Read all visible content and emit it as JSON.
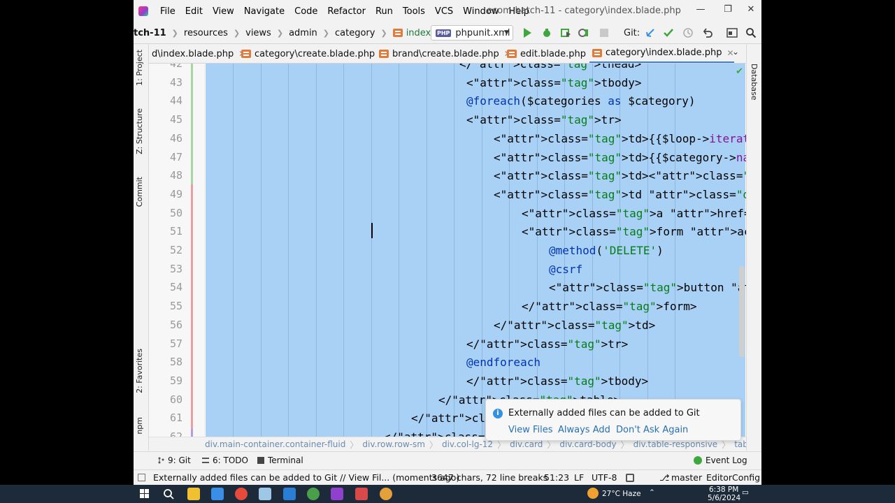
{
  "menubar": {
    "items": [
      "File",
      "Edit",
      "View",
      "Navigate",
      "Code",
      "Refactor",
      "Run",
      "Tools",
      "VCS",
      "Window",
      "Help"
    ],
    "window_title": "ecom-batch-11 - category\\index.blade.php"
  },
  "navbar": {
    "project": "tch-11",
    "crumbs": [
      "resources",
      "views",
      "admin",
      "category",
      "index.blade.php"
    ],
    "run_config": "phpunit.xml",
    "git_label": "Git:"
  },
  "tool_windows_left": [
    "1: Project",
    "Z: Structure",
    "Commit",
    "2: Favorites",
    "npm"
  ],
  "tool_windows_right": [
    "Database"
  ],
  "tabs": [
    {
      "label": "d\\index.blade.php"
    },
    {
      "label": "category\\create.blade.php"
    },
    {
      "label": "brand\\create.blade.php"
    },
    {
      "label": "edit.blade.php"
    },
    {
      "label": "category\\index.blade.php"
    }
  ],
  "editor": {
    "lines": [
      {
        "num": "42",
        "text": "</thead>"
      },
      {
        "num": "43",
        "text": "<tbody>"
      },
      {
        "num": "44",
        "text": "@foreach($categories as $category)"
      },
      {
        "num": "45",
        "text": "<tr>"
      },
      {
        "num": "46",
        "text": "<td>{{$loop->iteration}}</td>"
      },
      {
        "num": "47",
        "text": "<td>{{$category->name}}</td>"
      },
      {
        "num": "48",
        "text": "<td><img src=\"{{asset($category->im"
      },
      {
        "num": "49",
        "text": "<td class=\"d-flex\">"
      },
      {
        "num": "50",
        "text": "<a href=\"{{route('category.edit"
      },
      {
        "num": "51",
        "text": "<form action=\"{{route('category"
      },
      {
        "num": "52",
        "text": "@method('DELETE')"
      },
      {
        "num": "53",
        "text": "@csrf"
      },
      {
        "num": "54",
        "text": "<button type=\"submit\" class"
      },
      {
        "num": "55",
        "text": "</form>"
      },
      {
        "num": "56",
        "text": "</td>"
      },
      {
        "num": "57",
        "text": "</tr>"
      },
      {
        "num": "58",
        "text": "@endforeach"
      },
      {
        "num": "59",
        "text": "</tbody>"
      },
      {
        "num": "60",
        "text": "</table>"
      },
      {
        "num": "61",
        "text": "</div>"
      },
      {
        "num": "62",
        "text": "</div>"
      }
    ],
    "breadcrumbs": [
      "div.main-container.container-fluid",
      "div.row.row-sm",
      "div.col-lg-12",
      "div.card",
      "div.card-body",
      "div.table-responsive",
      "table#basic-data"
    ]
  },
  "notification": {
    "message": "Externally added files can be added to Git",
    "actions": [
      "View Files",
      "Always Add",
      "Don't Ask Again"
    ]
  },
  "bottom_tools": {
    "git": "9: Git",
    "todo": "6: TODO",
    "terminal": "Terminal",
    "event_log": "Event Log"
  },
  "statusbar": {
    "message": "Externally added files can be added to Git // View Fil... (moments ago)",
    "chars": "3647 chars, 72 line breaks",
    "position": "51:23",
    "line_sep": "LF",
    "encoding": "UTF-8",
    "branch": "master",
    "editorconfig": "EditorConfig"
  },
  "taskbar": {
    "weather": "27°C  Haze",
    "time": "6:38 PM",
    "date": "5/6/2024"
  },
  "colors": {
    "selection": "#a9d1f5",
    "accent": "#4083c9",
    "run_green": "#3ea83e",
    "link": "#2470b3"
  }
}
